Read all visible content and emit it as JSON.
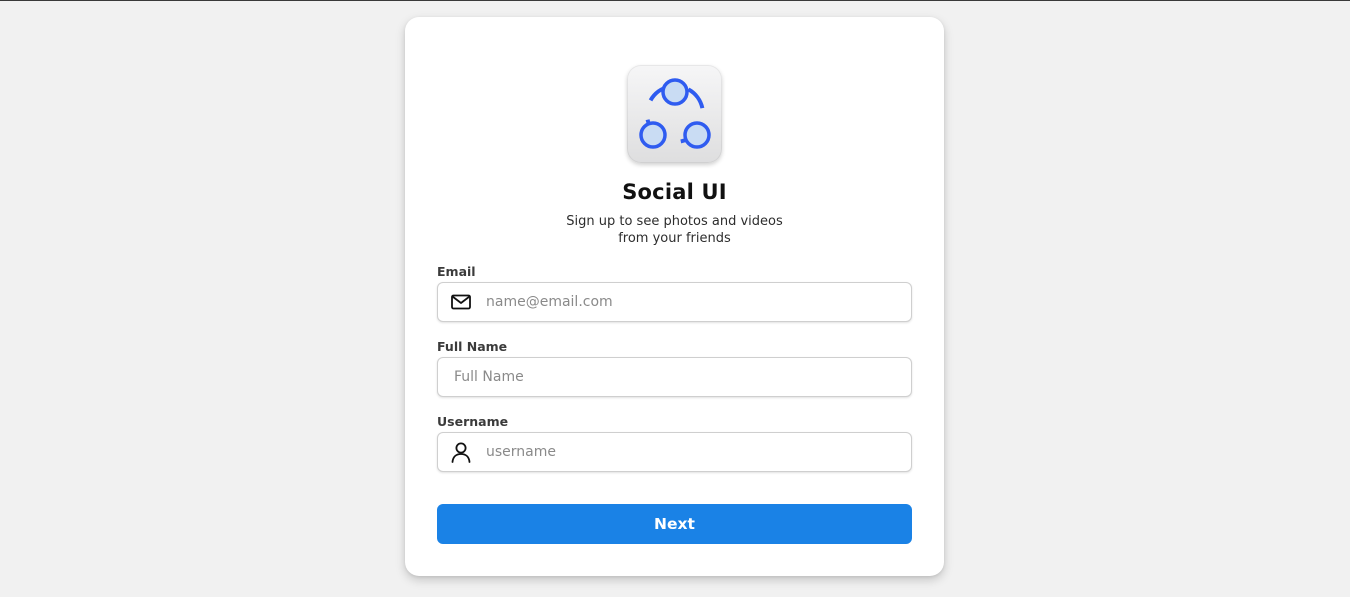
{
  "app": {
    "title": "Social UI",
    "subtitle_line1": "Sign up to see photos and videos",
    "subtitle_line2": "from your friends",
    "logo_icon": "share-nodes-icon",
    "logo_color": "#2f5cf0"
  },
  "form": {
    "email": {
      "label": "Email",
      "placeholder": "name@email.com",
      "value": "",
      "icon": "mail-icon"
    },
    "full_name": {
      "label": "Full Name",
      "placeholder": "Full Name",
      "value": ""
    },
    "username": {
      "label": "Username",
      "placeholder": "username",
      "value": "",
      "icon": "user-icon"
    },
    "submit": {
      "label": "Next",
      "color": "#1a82e6"
    }
  }
}
